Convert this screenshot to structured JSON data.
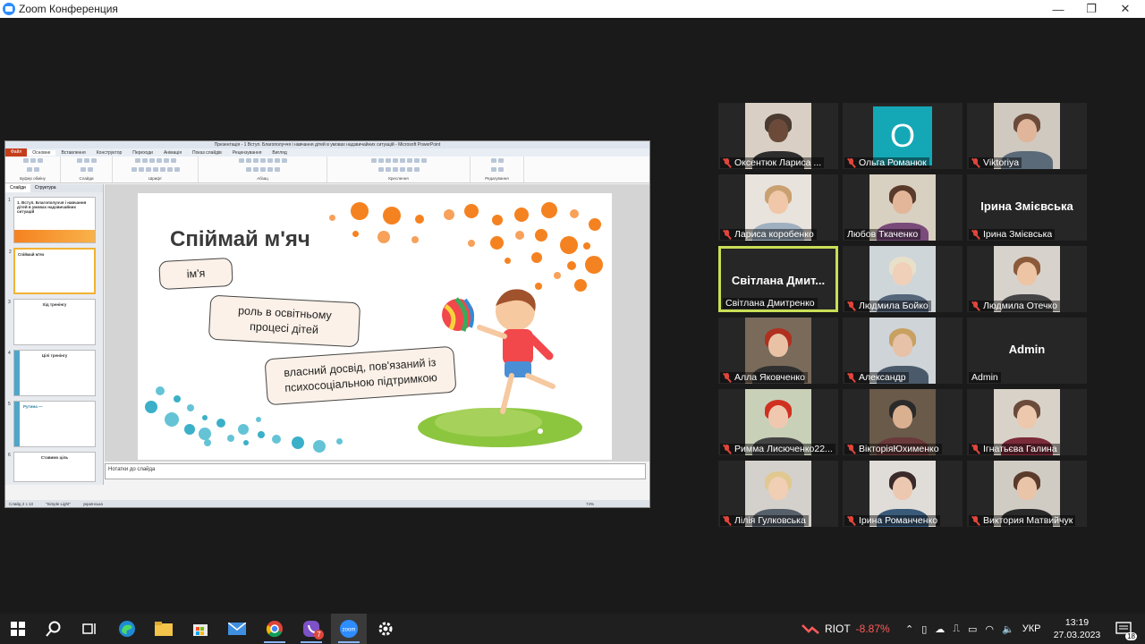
{
  "window": {
    "title": "Zoom Конференция",
    "minimize": "—",
    "maximize": "❐",
    "close": "✕"
  },
  "ppt": {
    "title": "Презентація - 1 Вступ. Благополуччя і навчання дітей в умовах надзвичайних ситуацій - Microsoft PowerPoint",
    "tabs": [
      "Файл",
      "Основне",
      "Вставлення",
      "Конструктор",
      "Переходи",
      "Анімація",
      "Показ слайдів",
      "Рецензування",
      "Вигляд"
    ],
    "groups": [
      "Буфер обміну",
      "Слайди",
      "Шрифт",
      "Абзац",
      "Креслення",
      "Редагування"
    ],
    "pane_tabs": [
      "Слайди",
      "Структура"
    ],
    "thumbs": [
      {
        "num": "1",
        "text": "1. Вступ. Благополуччя і навчання дітей в умовах надзвичайних ситуацій"
      },
      {
        "num": "2",
        "text": "Спіймай м'яч"
      },
      {
        "num": "3",
        "text": "Хід тренінгу"
      },
      {
        "num": "4",
        "text": "Цілі тренінгу"
      },
      {
        "num": "5",
        "text": "Рутина —"
      },
      {
        "num": "6",
        "text": "Ставимо ціль"
      }
    ],
    "notes": "Нотатки до слайда",
    "status": {
      "slide": "Слайд 2 з 13",
      "theme": "\"Simple Light\"",
      "lang": "українська",
      "zoom": "74%"
    }
  },
  "slide": {
    "title": "Спіймай м'яч",
    "bubbles": [
      "ім'я",
      "роль в освітньому процесі дітей",
      "власний досвід, пов'язаний із психосоціальною підтримкою"
    ]
  },
  "participants": [
    {
      "name": "Оксентюк Лариса ...",
      "muted": true,
      "video": true
    },
    {
      "name": "Ольга Романюк",
      "muted": true,
      "video": false,
      "avatar": "О"
    },
    {
      "name": "Viktoriya",
      "muted": true,
      "video": true
    },
    {
      "name": "Лариса коробенко",
      "muted": true,
      "video": true
    },
    {
      "name": "Любов Ткаченко",
      "muted": false,
      "video": true
    },
    {
      "name": "Ірина Змієвська",
      "muted": true,
      "video": false,
      "bigname": "Ірина Змієвська"
    },
    {
      "name": "Світлана Дмитренко",
      "muted": false,
      "video": false,
      "bigname": "Світлана Дмит...",
      "active": true
    },
    {
      "name": "Людмила Бойко",
      "muted": true,
      "video": true
    },
    {
      "name": "Людмила Отечко",
      "muted": true,
      "video": true
    },
    {
      "name": "Алла Яковченко",
      "muted": true,
      "video": true
    },
    {
      "name": "Александр",
      "muted": true,
      "video": true
    },
    {
      "name": "Admin",
      "muted": false,
      "video": false,
      "bigname": "Admin"
    },
    {
      "name": "Римма Лисюченко22...",
      "muted": true,
      "video": true
    },
    {
      "name": "ВікторіяЮхименко",
      "muted": true,
      "video": true
    },
    {
      "name": "Ігнатьєва Галина",
      "muted": true,
      "video": true
    },
    {
      "name": "Лілія Гулковська",
      "muted": true,
      "video": true
    },
    {
      "name": "Ірина Романченко",
      "muted": true,
      "video": true
    },
    {
      "name": "Виктория Матвийчук",
      "muted": true,
      "video": true
    }
  ],
  "taskbar": {
    "stock": {
      "ticker": "RIOT",
      "change": "-8.87%"
    },
    "lang": "УКР",
    "time": "13:19",
    "date": "27.03.2023",
    "notif_count": "18",
    "viber_badge": "7"
  },
  "colors": {
    "accent": "#f58220",
    "active_speaker": "#c9de55",
    "muted": "#e0453b",
    "stock_down": "#ff5a5a"
  }
}
